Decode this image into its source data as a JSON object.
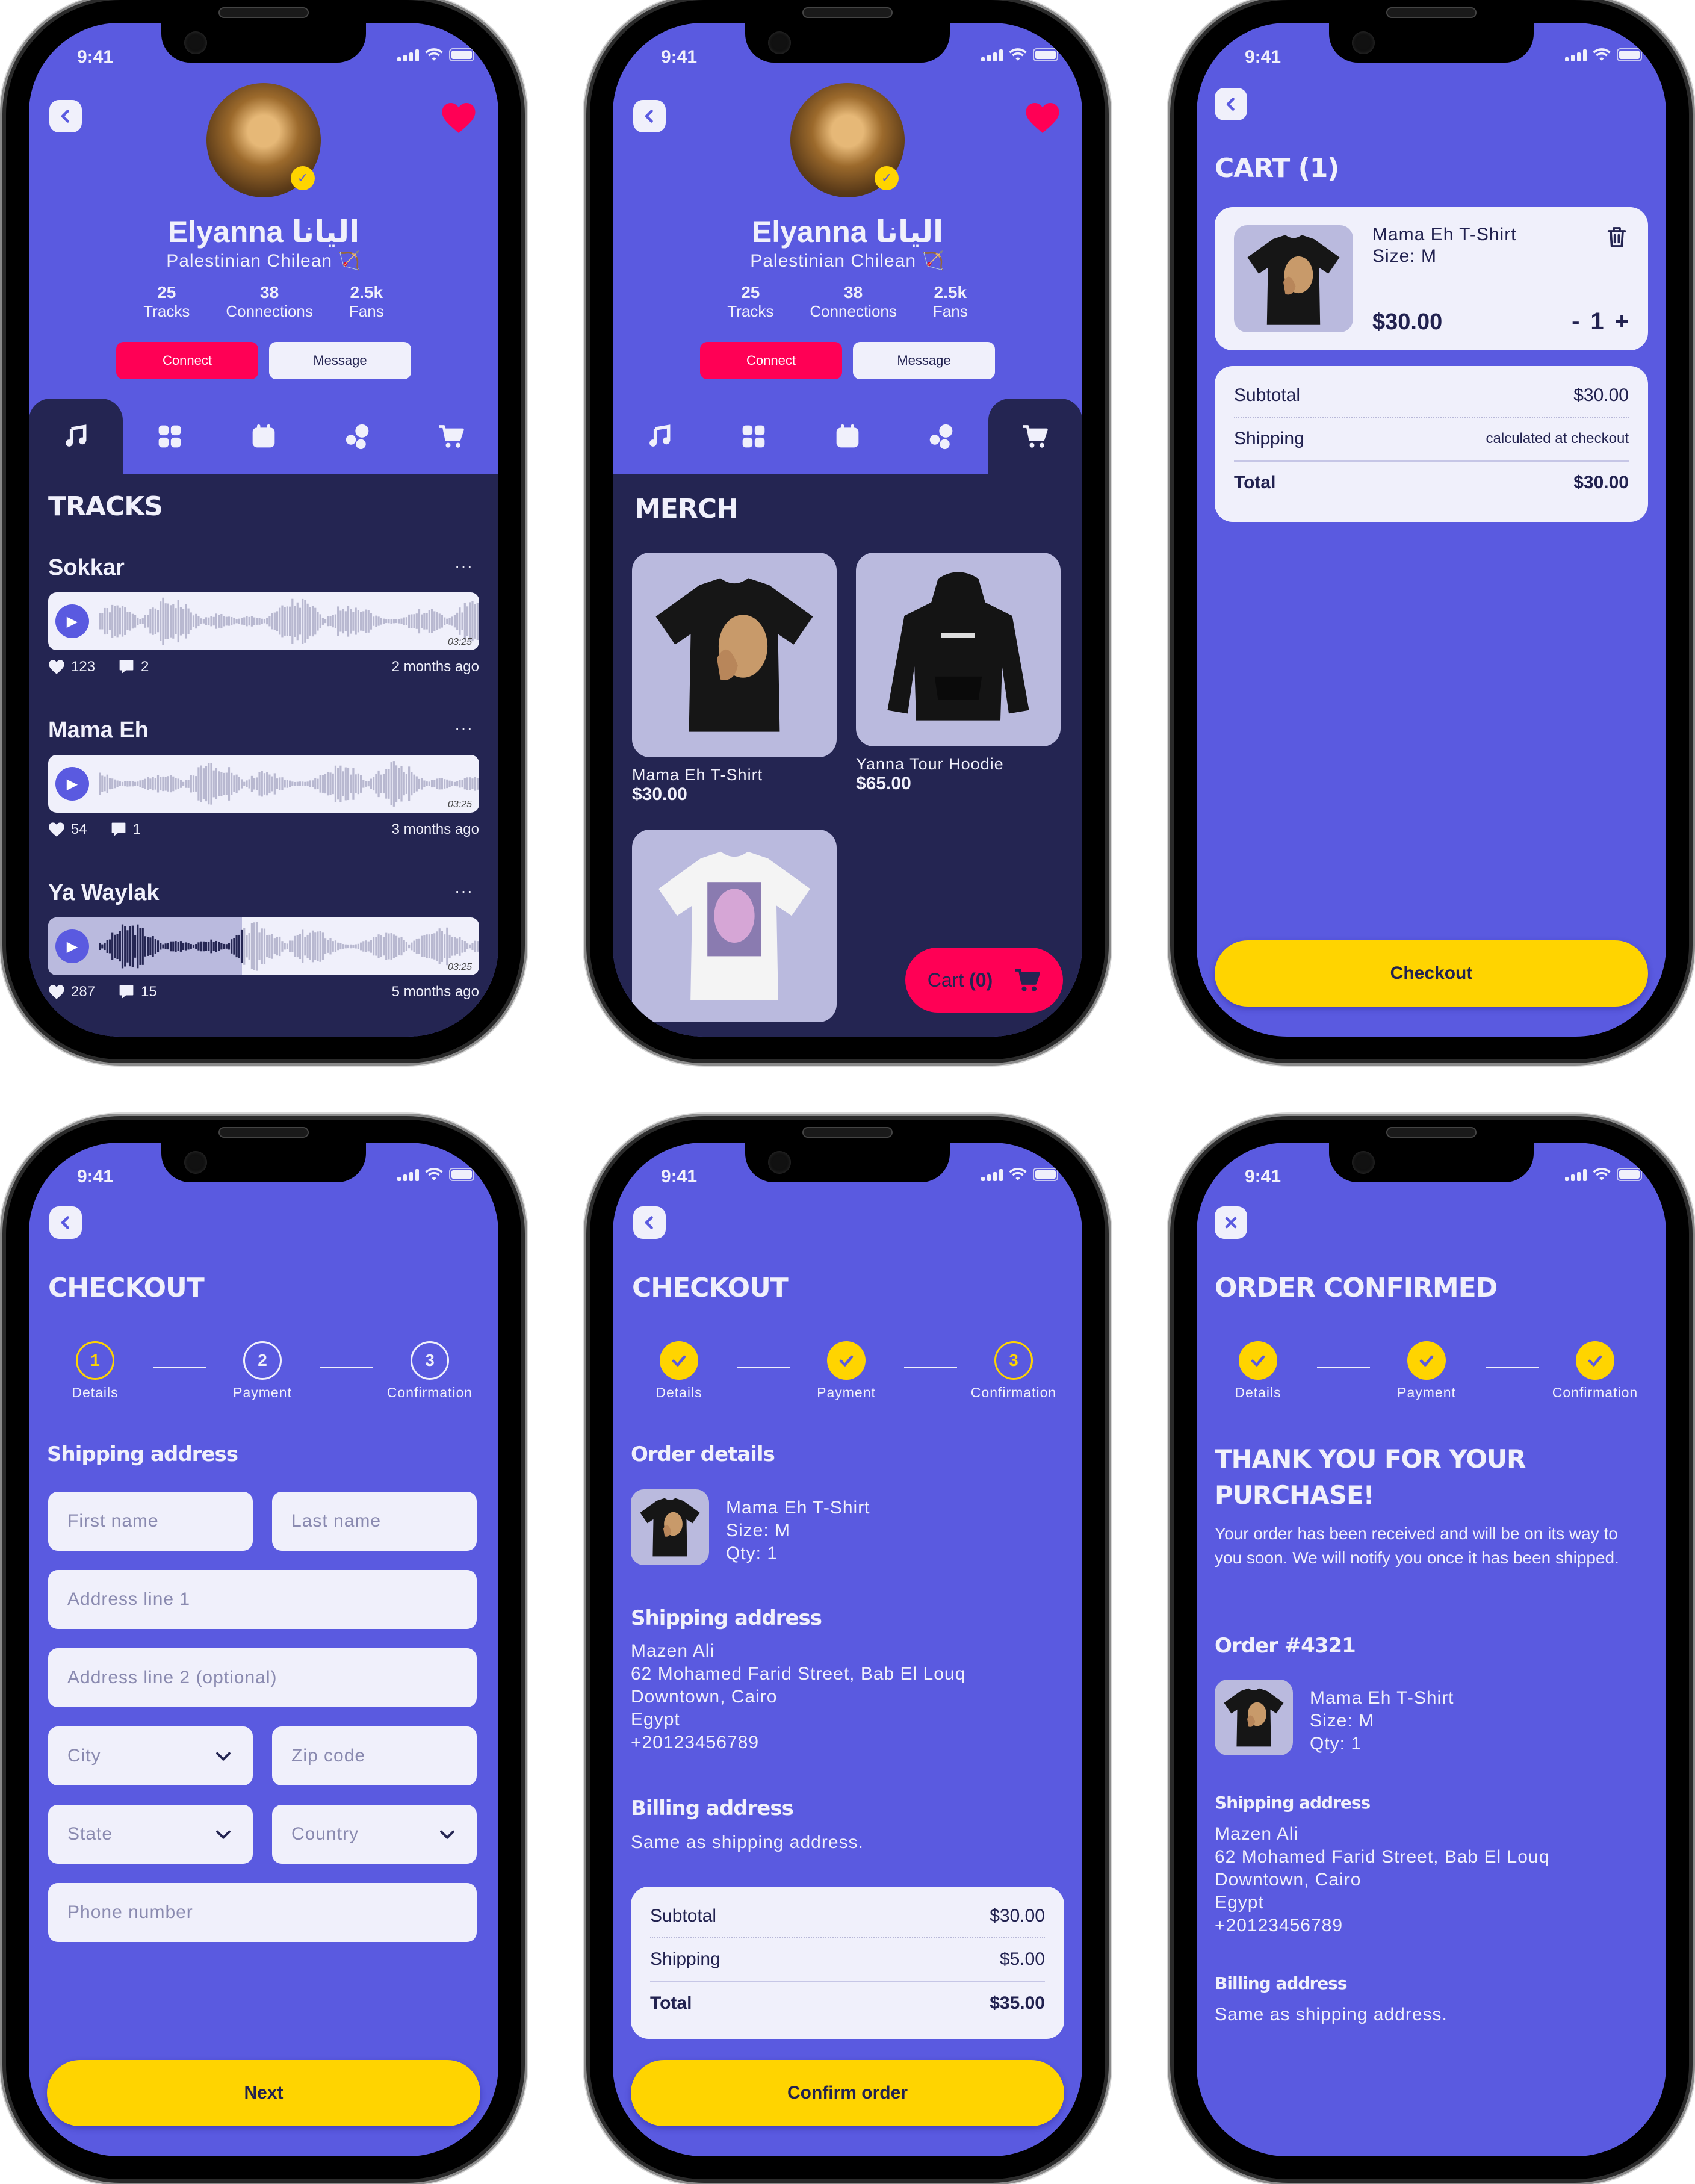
{
  "status_bar": {
    "time": "9:41"
  },
  "colors": {
    "primary": "#5a5ae0",
    "panel": "#242552",
    "accent_pink": "#ff0055",
    "accent_yellow": "#ffd400",
    "surface": "#f0f0fb",
    "lavender": "#babade"
  },
  "icons": {
    "back": "chevron-left-icon",
    "close": "close-icon",
    "favorite": "heart-icon",
    "verified": "verified-badge-icon",
    "trash": "trash-icon",
    "chevron_down": "chevron-down-icon",
    "play": "play-icon",
    "like": "heart-icon",
    "comment": "comment-icon",
    "more": "more-dots-icon",
    "cart": "cart-icon"
  },
  "profile": {
    "name": "Elyanna اليانا",
    "location": "Palestinian Chilean 🏹",
    "stats": [
      {
        "value": "25",
        "label": "Tracks"
      },
      {
        "value": "38",
        "label": "Connections"
      },
      {
        "value": "2.5k",
        "label": "Fans"
      }
    ],
    "connect_label": "Connect",
    "message_label": "Message",
    "tabs": [
      "tracks",
      "grid",
      "events",
      "community",
      "merch"
    ]
  },
  "tracks_screen": {
    "title": "TRACKS",
    "tracks": [
      {
        "title": "Sokkar",
        "duration": "03:25",
        "likes": "123",
        "comments": "2",
        "age": "2 months ago",
        "progress": 0
      },
      {
        "title": "Mama Eh",
        "duration": "03:25",
        "likes": "54",
        "comments": "1",
        "age": "3 months ago",
        "progress": 0
      },
      {
        "title": "Ya Waylak",
        "duration": "03:25",
        "likes": "287",
        "comments": "15",
        "age": "5 months ago",
        "progress": 0.45
      }
    ],
    "more_label": "···"
  },
  "merch_screen": {
    "title": "MERCH",
    "items": [
      {
        "name": "Mama Eh T-Shirt",
        "price": "$30.00"
      },
      {
        "name": "Yanna Tour Hoodie",
        "price": "$65.00"
      },
      {
        "name": "",
        "price": ""
      }
    ],
    "cart_label": "Cart",
    "cart_count": "(0)"
  },
  "cart_screen": {
    "title": "CART (1)",
    "item": {
      "name": "Mama Eh T-Shirt",
      "size": "Size: M",
      "price": "$30.00",
      "qty": "1",
      "minus": "-",
      "plus": "+"
    },
    "summary": {
      "subtotal_label": "Subtotal",
      "subtotal": "$30.00",
      "shipping_label": "Shipping",
      "shipping": "calculated at checkout",
      "total_label": "Total",
      "total": "$30.00"
    },
    "checkout_label": "Checkout"
  },
  "steps": [
    {
      "num": "1",
      "label": "Details"
    },
    {
      "num": "2",
      "label": "Payment"
    },
    {
      "num": "3",
      "label": "Confirmation"
    }
  ],
  "checkout_details": {
    "title": "CHECKOUT",
    "section": "Shipping address",
    "fields": {
      "first_name": "First name",
      "last_name": "Last name",
      "address1": "Address line 1",
      "address2": "Address line 2 (optional)",
      "city": "City",
      "zip": "Zip code",
      "state": "State",
      "country": "Country",
      "phone": "Phone number"
    },
    "next_label": "Next"
  },
  "checkout_review": {
    "title": "CHECKOUT",
    "order_section": "Order details",
    "item": {
      "name": "Mama Eh T-Shirt",
      "size": "Size: M",
      "qty": "Qty: 1"
    },
    "shipping_section": "Shipping address",
    "address": [
      "Mazen Ali",
      "62 Mohamed Farid Street, Bab El Louq",
      "Downtown, Cairo",
      "Egypt",
      "+20123456789"
    ],
    "billing_section": "Billing address",
    "billing_text": "Same as shipping address.",
    "summary": {
      "subtotal_label": "Subtotal",
      "subtotal": "$30.00",
      "shipping_label": "Shipping",
      "shipping": "$5.00",
      "total_label": "Total",
      "total": "$35.00"
    },
    "confirm_label": "Confirm order"
  },
  "order_confirmed": {
    "title": "ORDER CONFIRMED",
    "thanks": "THANK YOU FOR YOUR PURCHASE!",
    "message": "Your order has been received and will be on its way to you soon. We will notify you once it has been shipped.",
    "order_number": "Order #4321",
    "item": {
      "name": "Mama Eh T-Shirt",
      "size": "Size: M",
      "qty": "Qty: 1"
    },
    "shipping_section": "Shipping address",
    "address": [
      "Mazen Ali",
      "62 Mohamed Farid Street, Bab El Louq",
      "Downtown, Cairo",
      "Egypt",
      "+20123456789"
    ],
    "billing_section": "Billing address",
    "billing_text": "Same as shipping address."
  }
}
